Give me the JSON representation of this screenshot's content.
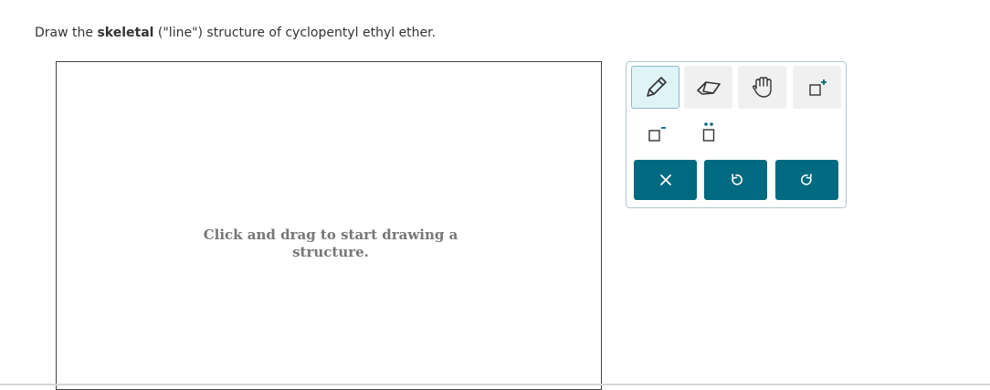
{
  "question": {
    "prefix": "Draw the ",
    "bold": "skeletal",
    "suffix": " (\"line\") structure of cyclopentyl ethyl ether."
  },
  "canvas": {
    "hint": "Click and drag to start drawing a structure."
  },
  "toolbox": {
    "tools": [
      {
        "name": "pencil-tool",
        "icon": "pencil-icon",
        "selected": true
      },
      {
        "name": "eraser-tool",
        "icon": "eraser-icon"
      },
      {
        "name": "hand-tool",
        "icon": "hand-icon"
      },
      {
        "name": "add-positive-charge-tool",
        "icon": "positive-charge-icon"
      },
      {
        "name": "add-negative-charge-tool",
        "icon": "negative-charge-icon"
      },
      {
        "name": "add-lone-pair-tool",
        "icon": "lone-pair-icon"
      }
    ],
    "actions": [
      {
        "name": "clear-button",
        "icon": "close-icon"
      },
      {
        "name": "undo-button",
        "icon": "undo-icon"
      },
      {
        "name": "redo-button",
        "icon": "redo-icon"
      }
    ],
    "accent": "#006a80"
  }
}
